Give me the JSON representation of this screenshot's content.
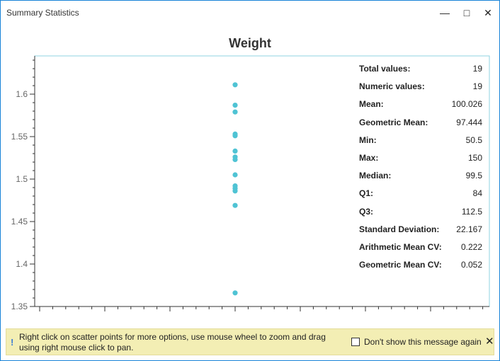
{
  "window": {
    "title": "Summary Statistics",
    "minimize_icon": "minimize-icon",
    "maximize_icon": "maximize-icon",
    "close_icon": "close-icon",
    "border_color": "#1883d7"
  },
  "chart_data": {
    "type": "scatter",
    "title": "Weight",
    "xlabel": "",
    "ylabel": "",
    "ylim": [
      1.35,
      1.645
    ],
    "yticks": [
      "1.35",
      "1.4",
      "1.45",
      "1.5",
      "1.55",
      "1.6"
    ],
    "color": "#4fc3d4",
    "grid": false,
    "points": [
      1.611,
      1.587,
      1.579,
      1.553,
      1.551,
      1.533,
      1.526,
      1.523,
      1.505,
      1.492,
      1.489,
      1.486,
      1.469,
      1.366
    ]
  },
  "stats": [
    {
      "label": "Total values:",
      "value": "19"
    },
    {
      "label": "Numeric values:",
      "value": "19"
    },
    {
      "label": "Mean:",
      "value": "100.026"
    },
    {
      "label": "Geometric Mean:",
      "value": "97.444"
    },
    {
      "label": "Min:",
      "value": "50.5"
    },
    {
      "label": "Max:",
      "value": "150"
    },
    {
      "label": "Median:",
      "value": "99.5"
    },
    {
      "label": "Q1:",
      "value": "84"
    },
    {
      "label": "Q3:",
      "value": "112.5"
    },
    {
      "label": "Standard Deviation:",
      "value": "22.167"
    },
    {
      "label": "Arithmetic Mean CV:",
      "value": "0.222"
    },
    {
      "label": "Geometric Mean CV:",
      "value": "0.052"
    }
  ],
  "footer": {
    "icon": "info-icon",
    "icon_glyph": "!",
    "message": "Right click on scatter points for more options, use mouse wheel to zoom and drag using right mouse click to pan.",
    "checkbox_label": "Don't show this message again",
    "checkbox_checked": false,
    "close_glyph": "✕",
    "background": "#f3eeb4"
  }
}
